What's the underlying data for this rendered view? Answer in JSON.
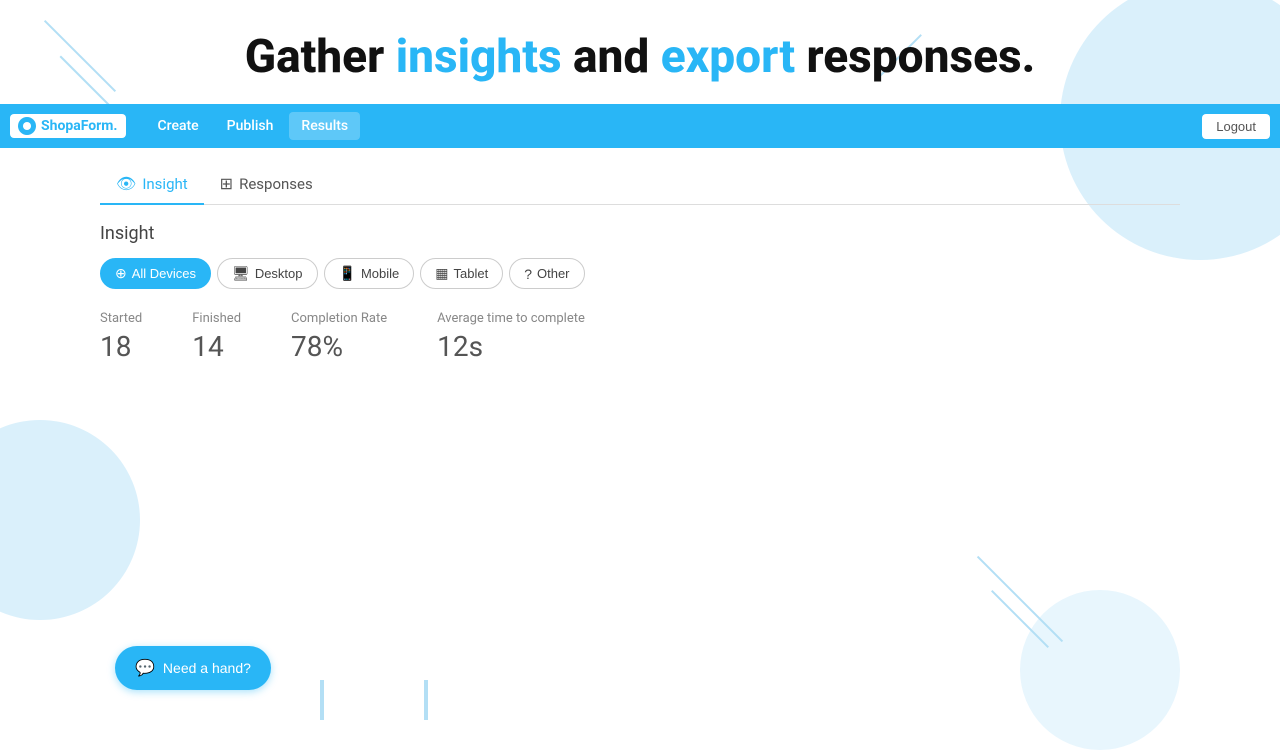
{
  "hero": {
    "text_before": "Gather ",
    "highlight1": "insights",
    "text_middle": " and ",
    "highlight2": "export",
    "text_after": " responses."
  },
  "navbar": {
    "brand_name": "ShopaForm.",
    "links": [
      {
        "label": "Create",
        "active": false
      },
      {
        "label": "Publish",
        "active": false
      },
      {
        "label": "Results",
        "active": true
      }
    ],
    "logout_label": "Logout"
  },
  "tabs": [
    {
      "label": "Insight",
      "icon": "👁",
      "active": true
    },
    {
      "label": "Responses",
      "icon": "⊞",
      "active": false
    }
  ],
  "section": {
    "heading": "Insight"
  },
  "device_filters": [
    {
      "label": "All Devices",
      "icon": "⊕",
      "active": true
    },
    {
      "label": "Desktop",
      "icon": "🖥",
      "active": false
    },
    {
      "label": "Mobile",
      "icon": "📱",
      "active": false
    },
    {
      "label": "Tablet",
      "icon": "▦",
      "active": false
    },
    {
      "label": "Other",
      "icon": "?",
      "active": false
    }
  ],
  "stats": [
    {
      "label": "Started",
      "value": "18"
    },
    {
      "label": "Finished",
      "value": "14"
    },
    {
      "label": "Completion Rate",
      "value": "78%"
    },
    {
      "label": "Average time to complete",
      "value": "12s"
    }
  ],
  "chat_button": {
    "label": "Need a hand?"
  }
}
